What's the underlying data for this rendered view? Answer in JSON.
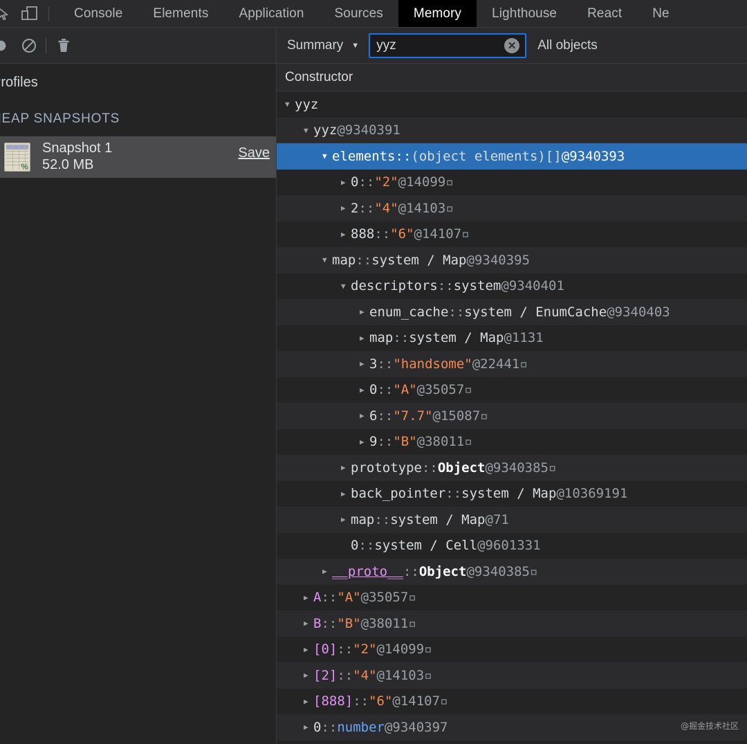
{
  "tabbar": {
    "icons": [
      {
        "name": "inspect-element-icon"
      },
      {
        "name": "device-toolbar-icon"
      }
    ],
    "tabs": [
      {
        "label": "Console",
        "active": false
      },
      {
        "label": "Elements",
        "active": false
      },
      {
        "label": "Application",
        "active": false
      },
      {
        "label": "Sources",
        "active": false
      },
      {
        "label": "Memory",
        "active": true
      },
      {
        "label": "Lighthouse",
        "active": false
      },
      {
        "label": "React",
        "active": false
      },
      {
        "label": "Ne",
        "active": false
      }
    ]
  },
  "toolbar": {
    "record_icon": "record-circle-icon",
    "clear_icon": "clear-prohibited-icon",
    "trash_icon": "trash-icon",
    "view_select": "Summary",
    "view_caret": "▼",
    "search": {
      "value": "yyz",
      "placeholder": "",
      "clear_label": "✕"
    },
    "filter_label": "All objects"
  },
  "sidebar": {
    "title": "Profiles",
    "group_label": "HEAP SNAPSHOTS",
    "snapshot": {
      "icon": "heap-snapshot-icon",
      "name": "Snapshot 1",
      "size": "52.0 MB",
      "save_label": "Save"
    }
  },
  "grid": {
    "columns": [
      "Constructor"
    ]
  },
  "tree": [
    {
      "indent": 0,
      "tri": "▼",
      "sel": false,
      "alt": false,
      "parts": [
        {
          "t": "yyz",
          "c": "name-obj"
        }
      ]
    },
    {
      "indent": 1,
      "tri": "▼",
      "sel": false,
      "alt": true,
      "parts": [
        {
          "t": "yyz",
          "c": "name-obj"
        },
        {
          "t": " ",
          "c": "sep"
        },
        {
          "t": "@9340391",
          "c": "id"
        }
      ]
    },
    {
      "indent": 2,
      "tri": "▼",
      "sel": true,
      "alt": false,
      "parts": [
        {
          "t": "elements",
          "c": "name-obj"
        },
        {
          "t": " :: ",
          "c": "sep"
        },
        {
          "t": "(object elements)[]",
          "c": "val-sys"
        },
        {
          "t": " ",
          "c": "sep"
        },
        {
          "t": "@9340393",
          "c": "id"
        }
      ]
    },
    {
      "indent": 3,
      "tri": "▶",
      "sel": false,
      "alt": false,
      "parts": [
        {
          "t": "0",
          "c": "name-obj"
        },
        {
          "t": " :: ",
          "c": "sep"
        },
        {
          "t": "\"2\"",
          "c": "val-str"
        },
        {
          "t": " ",
          "c": "sep"
        },
        {
          "t": "@14099",
          "c": "id"
        },
        {
          "t": " ▫",
          "c": "box"
        }
      ]
    },
    {
      "indent": 3,
      "tri": "▶",
      "sel": false,
      "alt": true,
      "parts": [
        {
          "t": "2",
          "c": "name-obj"
        },
        {
          "t": " :: ",
          "c": "sep"
        },
        {
          "t": "\"4\"",
          "c": "val-str"
        },
        {
          "t": " ",
          "c": "sep"
        },
        {
          "t": "@14103",
          "c": "id"
        },
        {
          "t": " ▫",
          "c": "box"
        }
      ]
    },
    {
      "indent": 3,
      "tri": "▶",
      "sel": false,
      "alt": false,
      "parts": [
        {
          "t": "888",
          "c": "name-obj"
        },
        {
          "t": " :: ",
          "c": "sep"
        },
        {
          "t": "\"6\"",
          "c": "val-str"
        },
        {
          "t": " ",
          "c": "sep"
        },
        {
          "t": "@14107",
          "c": "id"
        },
        {
          "t": " ▫",
          "c": "box"
        }
      ]
    },
    {
      "indent": 2,
      "tri": "▼",
      "sel": false,
      "alt": true,
      "parts": [
        {
          "t": "map",
          "c": "name-obj"
        },
        {
          "t": " :: ",
          "c": "sep"
        },
        {
          "t": "system / Map",
          "c": "val-sys"
        },
        {
          "t": " ",
          "c": "sep"
        },
        {
          "t": "@9340395",
          "c": "id"
        }
      ]
    },
    {
      "indent": 3,
      "tri": "▼",
      "sel": false,
      "alt": false,
      "parts": [
        {
          "t": "descriptors",
          "c": "name-obj"
        },
        {
          "t": " :: ",
          "c": "sep"
        },
        {
          "t": "system",
          "c": "val-sys"
        },
        {
          "t": " ",
          "c": "sep"
        },
        {
          "t": "@9340401",
          "c": "id"
        }
      ]
    },
    {
      "indent": 4,
      "tri": "▶",
      "sel": false,
      "alt": true,
      "parts": [
        {
          "t": "enum_cache",
          "c": "name-obj"
        },
        {
          "t": " :: ",
          "c": "sep"
        },
        {
          "t": "system / EnumCache",
          "c": "val-sys"
        },
        {
          "t": " ",
          "c": "sep"
        },
        {
          "t": "@9340403",
          "c": "id"
        }
      ]
    },
    {
      "indent": 4,
      "tri": "▶",
      "sel": false,
      "alt": false,
      "parts": [
        {
          "t": "map",
          "c": "name-obj"
        },
        {
          "t": " :: ",
          "c": "sep"
        },
        {
          "t": "system / Map",
          "c": "val-sys"
        },
        {
          "t": " ",
          "c": "sep"
        },
        {
          "t": "@1131",
          "c": "id"
        }
      ]
    },
    {
      "indent": 4,
      "tri": "▶",
      "sel": false,
      "alt": true,
      "parts": [
        {
          "t": "3",
          "c": "name-obj"
        },
        {
          "t": " :: ",
          "c": "sep"
        },
        {
          "t": "\"handsome\"",
          "c": "val-str"
        },
        {
          "t": " ",
          "c": "sep"
        },
        {
          "t": "@22441",
          "c": "id"
        },
        {
          "t": " ▫",
          "c": "box"
        }
      ]
    },
    {
      "indent": 4,
      "tri": "▶",
      "sel": false,
      "alt": false,
      "parts": [
        {
          "t": "0",
          "c": "name-obj"
        },
        {
          "t": " :: ",
          "c": "sep"
        },
        {
          "t": "\"A\"",
          "c": "val-str"
        },
        {
          "t": " ",
          "c": "sep"
        },
        {
          "t": "@35057",
          "c": "id"
        },
        {
          "t": " ▫",
          "c": "box"
        }
      ]
    },
    {
      "indent": 4,
      "tri": "▶",
      "sel": false,
      "alt": true,
      "parts": [
        {
          "t": "6",
          "c": "name-obj"
        },
        {
          "t": " :: ",
          "c": "sep"
        },
        {
          "t": "\"7.7\"",
          "c": "val-str"
        },
        {
          "t": " ",
          "c": "sep"
        },
        {
          "t": "@15087",
          "c": "id"
        },
        {
          "t": " ▫",
          "c": "box"
        }
      ]
    },
    {
      "indent": 4,
      "tri": "▶",
      "sel": false,
      "alt": false,
      "parts": [
        {
          "t": "9",
          "c": "name-obj"
        },
        {
          "t": " :: ",
          "c": "sep"
        },
        {
          "t": "\"B\"",
          "c": "val-str"
        },
        {
          "t": " ",
          "c": "sep"
        },
        {
          "t": "@38011",
          "c": "id"
        },
        {
          "t": " ▫",
          "c": "box"
        }
      ]
    },
    {
      "indent": 3,
      "tri": "▶",
      "sel": false,
      "alt": true,
      "parts": [
        {
          "t": "prototype",
          "c": "name-obj"
        },
        {
          "t": " :: ",
          "c": "sep"
        },
        {
          "t": "Object",
          "c": "val-obj"
        },
        {
          "t": " ",
          "c": "sep"
        },
        {
          "t": "@9340385",
          "c": "id"
        },
        {
          "t": " ▫",
          "c": "box"
        }
      ]
    },
    {
      "indent": 3,
      "tri": "▶",
      "sel": false,
      "alt": false,
      "parts": [
        {
          "t": "back_pointer",
          "c": "name-obj"
        },
        {
          "t": " :: ",
          "c": "sep"
        },
        {
          "t": "system / Map",
          "c": "val-sys"
        },
        {
          "t": " ",
          "c": "sep"
        },
        {
          "t": "@10369191",
          "c": "id"
        }
      ]
    },
    {
      "indent": 3,
      "tri": "▶",
      "sel": false,
      "alt": true,
      "parts": [
        {
          "t": "map",
          "c": "name-obj"
        },
        {
          "t": " :: ",
          "c": "sep"
        },
        {
          "t": "system / Map",
          "c": "val-sys"
        },
        {
          "t": " ",
          "c": "sep"
        },
        {
          "t": "@71",
          "c": "id"
        }
      ]
    },
    {
      "indent": 3,
      "tri": "",
      "sel": false,
      "alt": false,
      "parts": [
        {
          "t": "0",
          "c": "name-obj"
        },
        {
          "t": " :: ",
          "c": "sep"
        },
        {
          "t": "system / Cell",
          "c": "val-sys"
        },
        {
          "t": " ",
          "c": "sep"
        },
        {
          "t": "@9601331",
          "c": "id"
        }
      ]
    },
    {
      "indent": 2,
      "tri": "▶",
      "sel": false,
      "alt": true,
      "parts": [
        {
          "t": "__proto__",
          "c": "name-proto"
        },
        {
          "t": " :: ",
          "c": "sep"
        },
        {
          "t": "Object",
          "c": "val-obj"
        },
        {
          "t": " ",
          "c": "sep"
        },
        {
          "t": "@9340385",
          "c": "id"
        },
        {
          "t": " ▫",
          "c": "box"
        }
      ]
    },
    {
      "indent": 1,
      "tri": "▶",
      "sel": false,
      "alt": false,
      "parts": [
        {
          "t": "A",
          "c": "name-prop"
        },
        {
          "t": " :: ",
          "c": "sep"
        },
        {
          "t": "\"A\"",
          "c": "val-str"
        },
        {
          "t": " ",
          "c": "sep"
        },
        {
          "t": "@35057",
          "c": "id"
        },
        {
          "t": " ▫",
          "c": "box"
        }
      ]
    },
    {
      "indent": 1,
      "tri": "▶",
      "sel": false,
      "alt": true,
      "parts": [
        {
          "t": "B",
          "c": "name-prop"
        },
        {
          "t": " :: ",
          "c": "sep"
        },
        {
          "t": "\"B\"",
          "c": "val-str"
        },
        {
          "t": " ",
          "c": "sep"
        },
        {
          "t": "@38011",
          "c": "id"
        },
        {
          "t": " ▫",
          "c": "box"
        }
      ]
    },
    {
      "indent": 1,
      "tri": "▶",
      "sel": false,
      "alt": false,
      "parts": [
        {
          "t": "[0]",
          "c": "name-prop"
        },
        {
          "t": " :: ",
          "c": "sep"
        },
        {
          "t": "\"2\"",
          "c": "val-str"
        },
        {
          "t": " ",
          "c": "sep"
        },
        {
          "t": "@14099",
          "c": "id"
        },
        {
          "t": " ▫",
          "c": "box"
        }
      ]
    },
    {
      "indent": 1,
      "tri": "▶",
      "sel": false,
      "alt": true,
      "parts": [
        {
          "t": "[2]",
          "c": "name-prop"
        },
        {
          "t": " :: ",
          "c": "sep"
        },
        {
          "t": "\"4\"",
          "c": "val-str"
        },
        {
          "t": " ",
          "c": "sep"
        },
        {
          "t": "@14103",
          "c": "id"
        },
        {
          "t": " ▫",
          "c": "box"
        }
      ]
    },
    {
      "indent": 1,
      "tri": "▶",
      "sel": false,
      "alt": false,
      "parts": [
        {
          "t": "[888]",
          "c": "name-prop"
        },
        {
          "t": " :: ",
          "c": "sep"
        },
        {
          "t": "\"6\"",
          "c": "val-str"
        },
        {
          "t": " ",
          "c": "sep"
        },
        {
          "t": "@14107",
          "c": "id"
        },
        {
          "t": " ▫",
          "c": "box"
        }
      ]
    },
    {
      "indent": 1,
      "tri": "▶",
      "sel": false,
      "alt": true,
      "parts": [
        {
          "t": "0",
          "c": "name-obj"
        },
        {
          "t": " :: ",
          "c": "sep"
        },
        {
          "t": "number",
          "c": "val-num"
        },
        {
          "t": " ",
          "c": "sep"
        },
        {
          "t": "@9340397",
          "c": "id"
        }
      ]
    }
  ],
  "watermark": "@掘金技术社区",
  "colors": {
    "accent_blue": "#1a73e8",
    "selection_blue": "#2a6fb5",
    "string_orange": "#f28b54",
    "property_magenta": "#e292f5",
    "number_blue": "#6aa6f8",
    "background": "#242424",
    "panel": "#2b2b2e"
  }
}
